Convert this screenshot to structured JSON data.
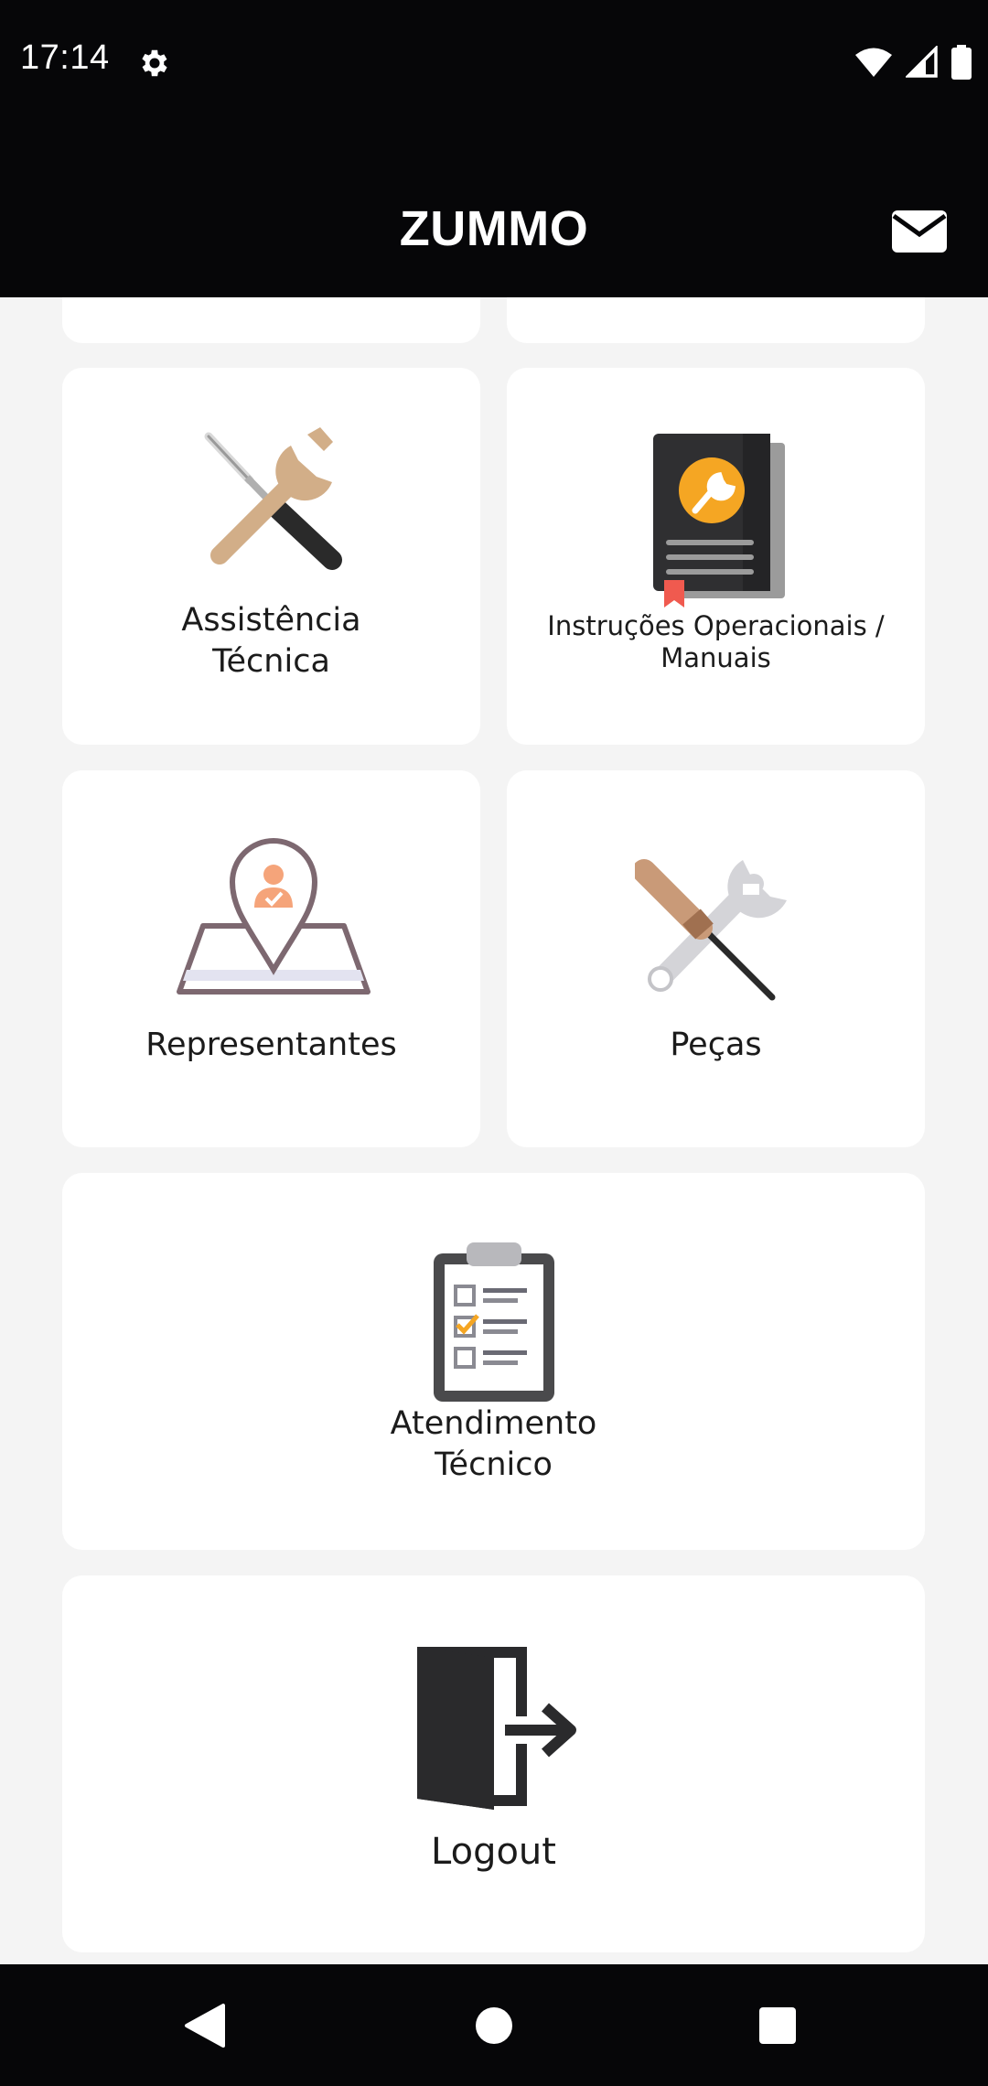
{
  "status_bar": {
    "time": "17:14",
    "icons": [
      "gear-icon",
      "wifi-icon",
      "signal-icon",
      "battery-icon"
    ]
  },
  "app_bar": {
    "title": "ZUMMO",
    "action_icon": "mail-icon"
  },
  "menu": {
    "items": [
      {
        "label": "Assistência\nTécnica",
        "icon": "tools-icon"
      },
      {
        "label": "Instruções Operacionais /\nManuais",
        "icon": "manual-book-icon"
      },
      {
        "label": "Representantes",
        "icon": "map-pin-person-icon"
      },
      {
        "label": "Peças",
        "icon": "screwdriver-wrench-icon"
      },
      {
        "label": "Atendimento\nTécnico",
        "icon": "clipboard-checklist-icon"
      },
      {
        "label": "Logout",
        "icon": "logout-door-icon"
      }
    ]
  },
  "navigation": {
    "buttons": [
      "back-icon",
      "home-icon",
      "recents-icon"
    ]
  },
  "colors": {
    "bar_background": "#060608",
    "page_background": "#f4f4f4",
    "card_background": "#ffffff",
    "accent_tan": "#d2ae88",
    "accent_orange": "#f5a623",
    "accent_red": "#f05a4f"
  }
}
